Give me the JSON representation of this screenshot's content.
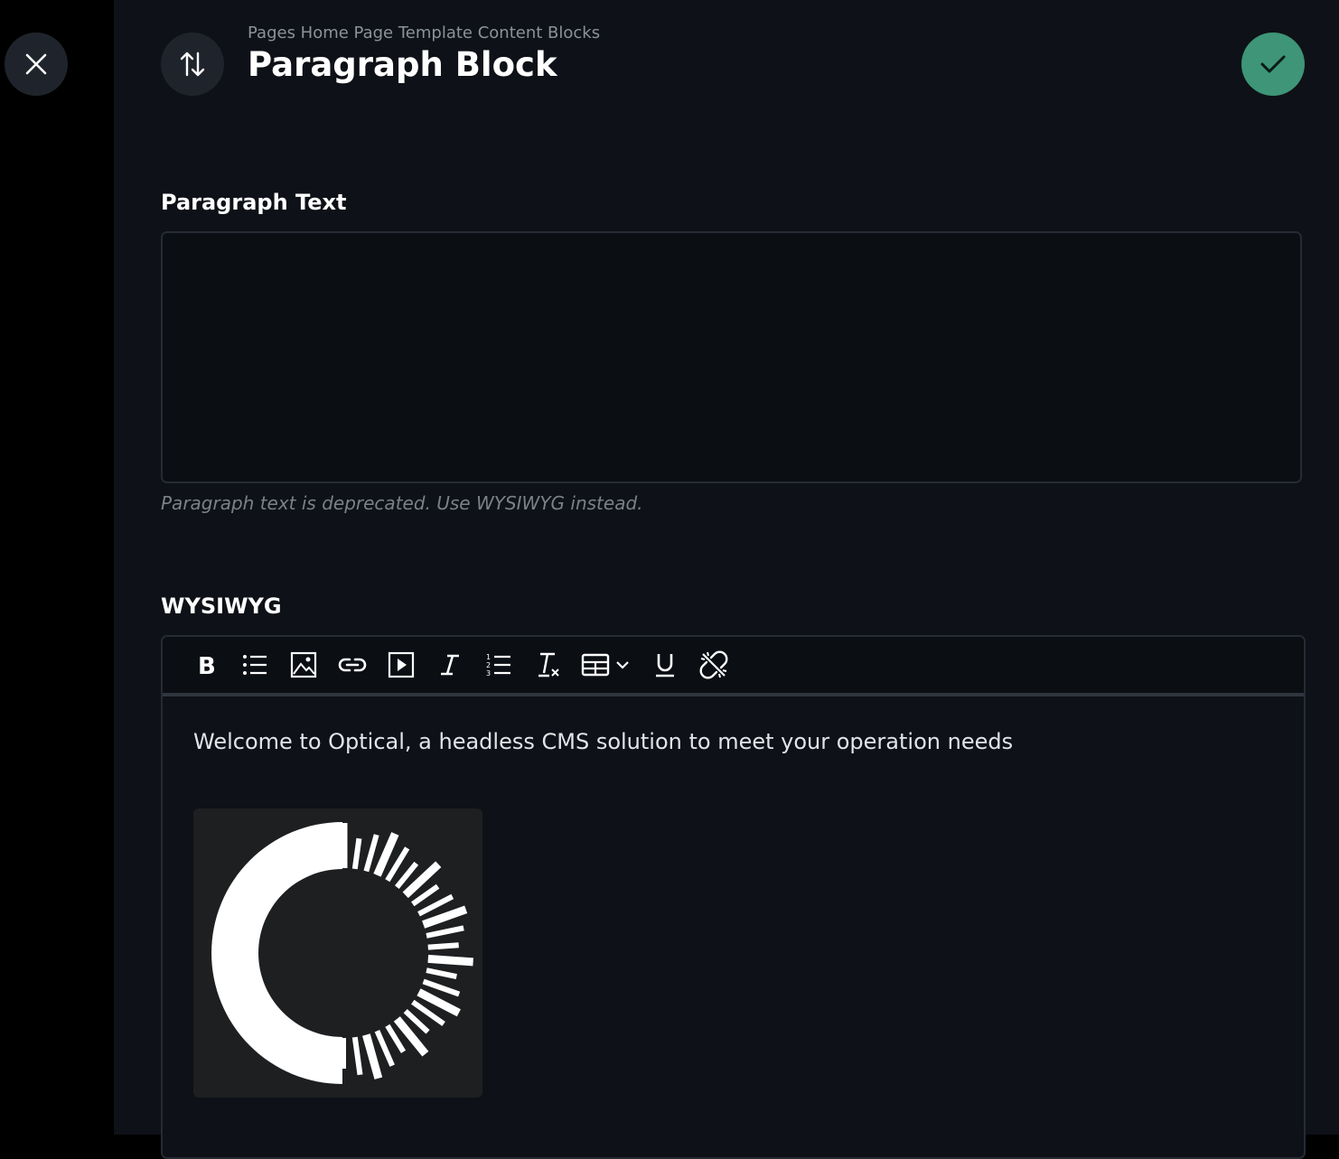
{
  "header": {
    "breadcrumb": "Pages Home Page Template Content Blocks",
    "title": "Paragraph Block",
    "close_icon": "close-icon",
    "reorder_icon": "arrows-up-down-icon",
    "save_icon": "check-icon"
  },
  "paragraph_field": {
    "label": "Paragraph Text",
    "value": "",
    "help": "Paragraph text is deprecated. Use WYSIWYG instead."
  },
  "wysiwyg_field": {
    "label": "WYSIWYG",
    "toolbar": [
      "bold-icon",
      "bullet-list-icon",
      "image-icon",
      "link-icon",
      "video-icon",
      "italic-icon",
      "numbered-list-icon",
      "clear-format-icon",
      "table-icon",
      "underline-icon",
      "unlink-icon"
    ],
    "content": "Welcome to Optical, a headless CMS solution to meet your operation needs",
    "image_icon": "optical-logo-icon"
  },
  "colors": {
    "panel_bg": "#0e1117",
    "accent_green": "#3e9577",
    "button_bg": "#1f242c"
  }
}
